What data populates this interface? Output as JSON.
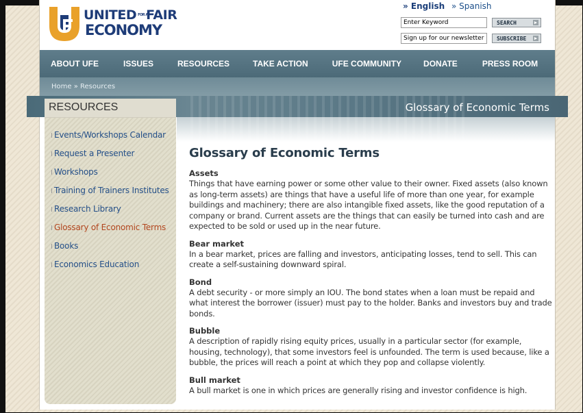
{
  "header": {
    "brand_line1": "UNITED",
    "brand_for_a": "FOR A",
    "brand_line1b": "FAIR",
    "brand_line2": "ECONOMY",
    "languages": [
      "» English",
      "» Spanish"
    ],
    "selected_language": "English",
    "keyword_value": "Enter Keyword",
    "search_label": "SEARCH",
    "newsletter_value": "Sign up for our newsletter",
    "subscribe_label": "SUBSCRIBE"
  },
  "nav": [
    "ABOUT UFE",
    "ISSUES",
    "RESOURCES",
    "TAKE ACTION",
    "UFE COMMUNITY",
    "DONATE",
    "PRESS ROOM"
  ],
  "breadcrumb": "Home » Resources",
  "band_title": "Glossary of Economic Terms",
  "sidebar": {
    "title": "RESOURCES",
    "items": [
      "Events/Workshops Calendar",
      "Request a Presenter",
      "Workshops",
      "Training of Trainers Institutes",
      "Research Library",
      "Glossary of Economic Terms",
      "Books",
      "Economics Education"
    ],
    "active_index": 5
  },
  "content": {
    "heading": "Glossary of Economic Terms",
    "terms": [
      {
        "name": "Assets",
        "definition": "Things that have earning power or some other value to their owner. Fixed assets (also known as long-term assets) are things that have a useful life of more than one year, for example buildings and machinery; there are also intangible fixed assets, like the good reputation of a company or brand. Current assets are the things that can easily be turned into cash and are expected to be sold or used up in the near future."
      },
      {
        "name": "Bear market",
        "definition": "In a bear market, prices are falling and investors, anticipating losses, tend to sell. This can create a self-sustaining downward spiral."
      },
      {
        "name": "Bond",
        "definition": "A debt security - or more simply an IOU. The bond states when a loan must be repaid and what interest the borrower (issuer) must pay to the holder. Banks and investors buy and trade bonds."
      },
      {
        "name": "Bubble",
        "definition": "A description of rapidly rising equity prices, usually in a particular sector (for example, housing, technology), that some investors feel is unfounded. The term is used because, like a bubble, the prices will reach a point at which they pop and collapse violently."
      },
      {
        "name": "Bull market",
        "definition": "A bull market is one in which prices are generally rising and investor confidence is high."
      }
    ]
  },
  "colors": {
    "nav_bg": "#55737f",
    "link": "#244f88",
    "active_link": "#b2461e",
    "logo_orange": "#e9a12a",
    "logo_navy": "#1e3c78"
  }
}
